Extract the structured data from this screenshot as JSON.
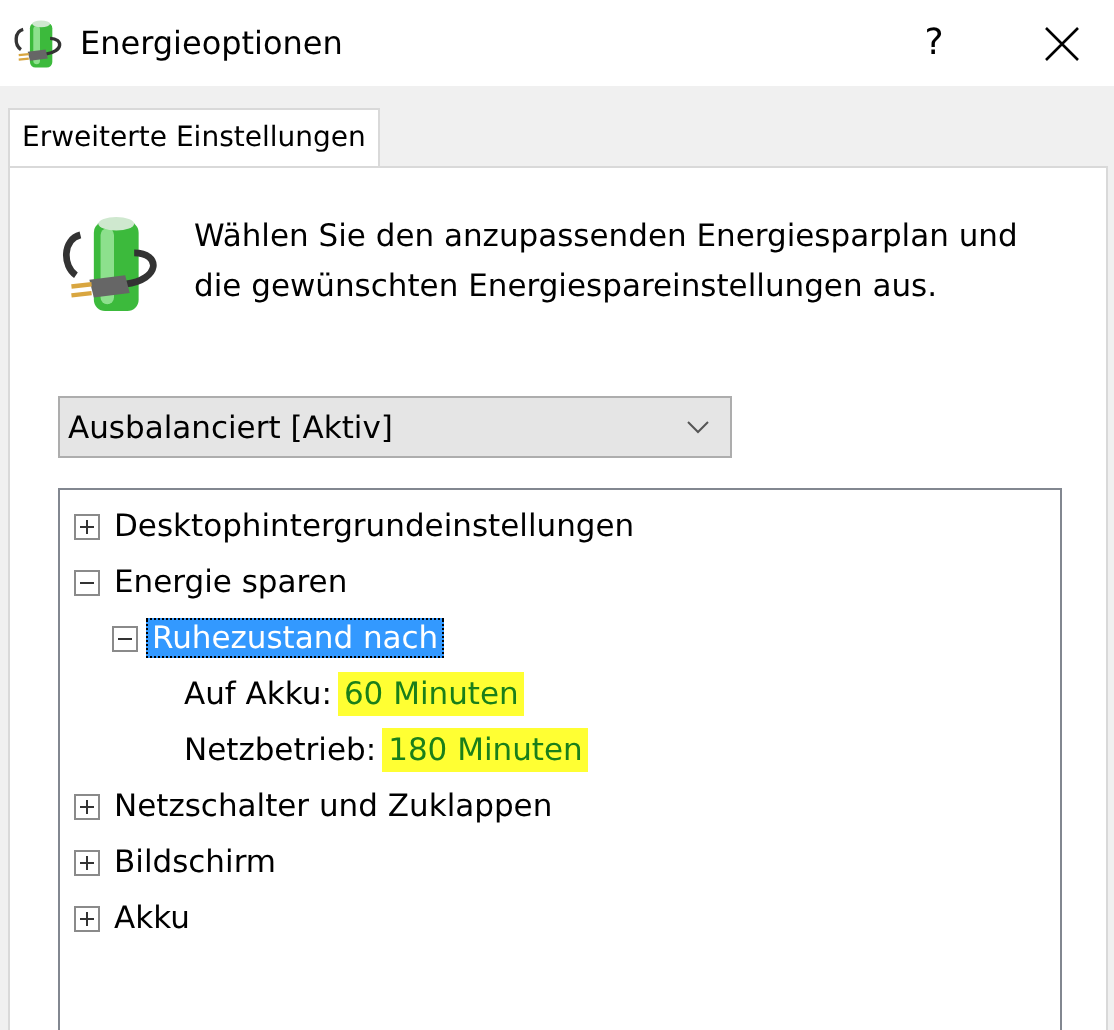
{
  "window": {
    "title": "Energieoptionen",
    "help": "?"
  },
  "tabs": [
    {
      "label": "Erweiterte Einstellungen",
      "selected": true
    }
  ],
  "intro": "Wählen Sie den anzupassenden Energiesparplan und die gewünschten Energiespareinstellungen aus.",
  "plan_dropdown": {
    "value": "Ausbalanciert [Aktiv]"
  },
  "tree": [
    {
      "kind": "group",
      "label": "Desktophintergrundeinstellungen",
      "expanded": false,
      "selected": false
    },
    {
      "kind": "group",
      "label": "Energie sparen",
      "expanded": true,
      "selected": false,
      "children": [
        {
          "kind": "group",
          "label": "Ruhezustand nach",
          "expanded": true,
          "selected": true,
          "children": [
            {
              "kind": "setting",
              "label": "Auf Akku:",
              "value": "60 Minuten",
              "highlighted": true
            },
            {
              "kind": "setting",
              "label": "Netzbetrieb:",
              "value": "180 Minuten",
              "highlighted": true
            }
          ]
        }
      ]
    },
    {
      "kind": "group",
      "label": "Netzschalter und Zuklappen",
      "expanded": false,
      "selected": false
    },
    {
      "kind": "group",
      "label": "Bildschirm",
      "expanded": false,
      "selected": false
    },
    {
      "kind": "group",
      "label": "Akku",
      "expanded": false,
      "selected": false
    }
  ]
}
